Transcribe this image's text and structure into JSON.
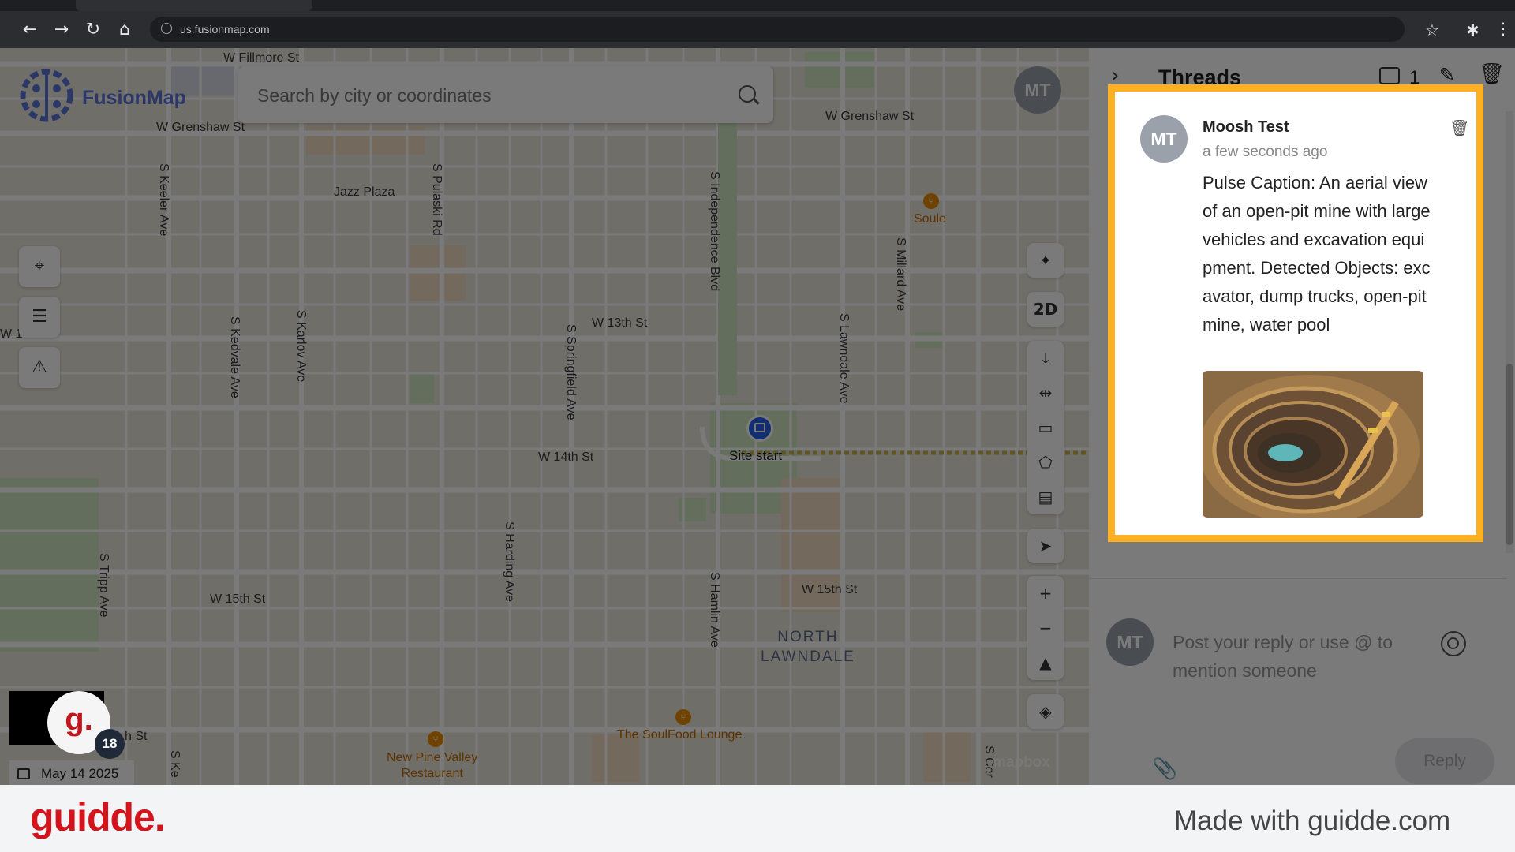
{
  "browser": {
    "url": "us.fusionmap.com",
    "icons": [
      "back-arrow-icon",
      "forward-arrow-icon",
      "reload-icon",
      "home-icon",
      "globe-icon",
      "star-icon",
      "extensions-icon",
      "kebab-menu-icon"
    ]
  },
  "map": {
    "brand": "FusionMap",
    "search_placeholder": "Search by city or coordinates",
    "user_initials": "MT",
    "streets": {
      "w_fillmore": "W Fillmore St",
      "w_grenshaw_left": "W Grenshaw St",
      "w_grenshaw_right": "W Grenshaw St",
      "w_13th": "W 13th St",
      "w_14th": "W 14th St",
      "w_15th_left": "W 15th St",
      "w_15th_right": "W 15th St",
      "w_partial": "W 1",
      "st_partial": "h St",
      "keeler": "S Keeler Ave",
      "pulaski": "S Pulaski Rd",
      "independence": "S Independence Blvd",
      "millard": "S Millard Ave",
      "kedvale": "S Kedvale Ave",
      "karlov": "S Karlov Ave",
      "springfield": "S Springfield Ave",
      "lawndale": "S Lawndale Ave",
      "harding": "S Harding Ave",
      "hamlin": "S Hamlin Ave",
      "tripp": "S Tripp Ave",
      "ke_partial": "S Ke",
      "cer_partial": "S Cer"
    },
    "places": {
      "jazz_plaza": "Jazz Plaza",
      "soule": "Soule",
      "site_start": "Site start",
      "area_line1": "NORTH",
      "area_line2": "LAWNDALE",
      "soulfood": "The SoulFood Lounge",
      "newpine_line1": "New Pine Valley",
      "newpine_line2": "Restaurant"
    },
    "toolbar_2d": "2D",
    "attribution": "mapbox",
    "date": "May 14 2025",
    "notification_count": "18",
    "g_letter": "g."
  },
  "panel": {
    "title": "Threads",
    "comment_count": "1",
    "thread": {
      "initials": "MT",
      "author": "Moosh Test",
      "time": "a few seconds ago",
      "body": "Pulse Caption: An aerial view of an open-pit mine with large vehicles and excavation equipment. Detected Objects: excavator, dump trucks, open-pit mine, water pool"
    },
    "reply": {
      "initials": "MT",
      "placeholder": "Post your reply or use @ to mention someone",
      "button": "Reply"
    }
  },
  "footer": {
    "brand": "guidde.",
    "made_with": "Made with guidde.com"
  },
  "colors": {
    "highlight": "#fdb022",
    "brand_red": "#d4141c",
    "fusion_blue": "#5b74d6"
  }
}
